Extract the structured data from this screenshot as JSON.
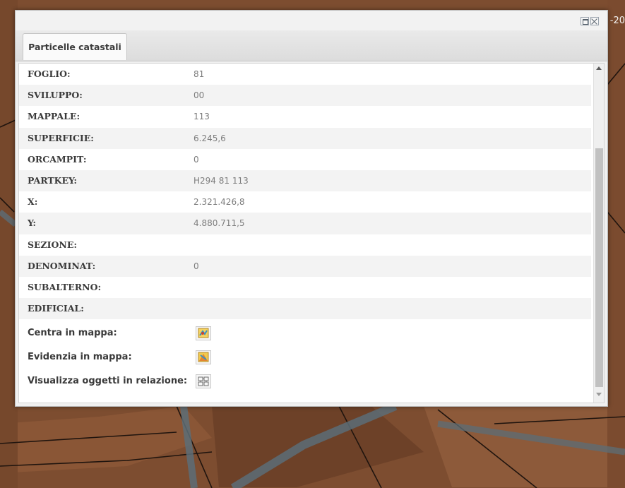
{
  "window": {
    "tab_label": "Particelle catastali",
    "corner_text": "-20"
  },
  "attributes": [
    {
      "label": "FOGLIO:",
      "value": "81"
    },
    {
      "label": "SVILUPPO:",
      "value": "00"
    },
    {
      "label": "MAPPALE:",
      "value": "113"
    },
    {
      "label": "SUPERFICIE:",
      "value": "6.245,6"
    },
    {
      "label": "ORCAMPIT:",
      "value": "0"
    },
    {
      "label": "PARTKEY:",
      "value": "H294 81 113"
    },
    {
      "label": "X:",
      "value": "2.321.426,8"
    },
    {
      "label": "Y:",
      "value": "4.880.711,5"
    },
    {
      "label": "SEZIONE:",
      "value": ""
    },
    {
      "label": "DENOMINAT:",
      "value": "0"
    },
    {
      "label": "SUBALTERNO:",
      "value": ""
    },
    {
      "label": "EDIFICIAL:",
      "value": ""
    }
  ],
  "actions": [
    {
      "label": "Centra in mappa:",
      "icon": "map-center-icon"
    },
    {
      "label": "Evidenzia in mappa:",
      "icon": "map-highlight-icon"
    },
    {
      "label": "Visualizza oggetti in relazione:",
      "icon": "related-objects-icon"
    }
  ],
  "colors": {
    "map_background": "#7a4a2e",
    "panel_background": "#f0f0f0",
    "label_text": "#3a3a3a",
    "value_text": "#7d7d7d"
  }
}
